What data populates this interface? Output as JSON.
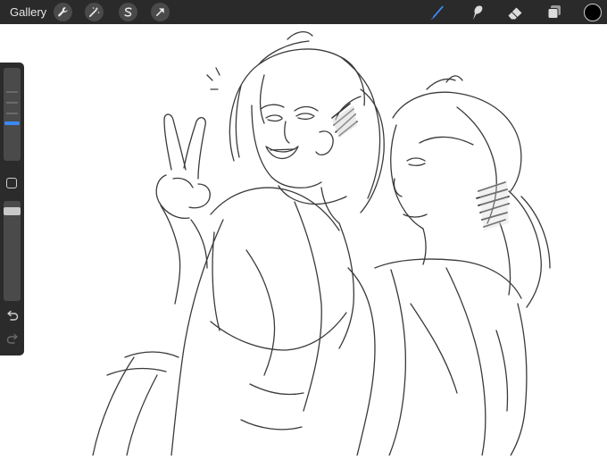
{
  "topbar": {
    "gallery_label": "Gallery",
    "left_tools": [
      "wrench-icon",
      "magic-wand-icon",
      "selection-icon",
      "transform-arrow-icon"
    ],
    "right_tools": [
      "brush-icon",
      "smudge-icon",
      "eraser-icon",
      "layers-icon"
    ],
    "active_tool": "brush-icon",
    "accent_color": "#3d8af7",
    "current_color": "#000000"
  },
  "sidebar": {
    "tools": [
      "brush-size-slider",
      "modify-button",
      "opacity-slider",
      "undo-icon",
      "redo-icon"
    ]
  },
  "canvas": {
    "background": "#ffffff",
    "content": "pencil-sketch"
  }
}
